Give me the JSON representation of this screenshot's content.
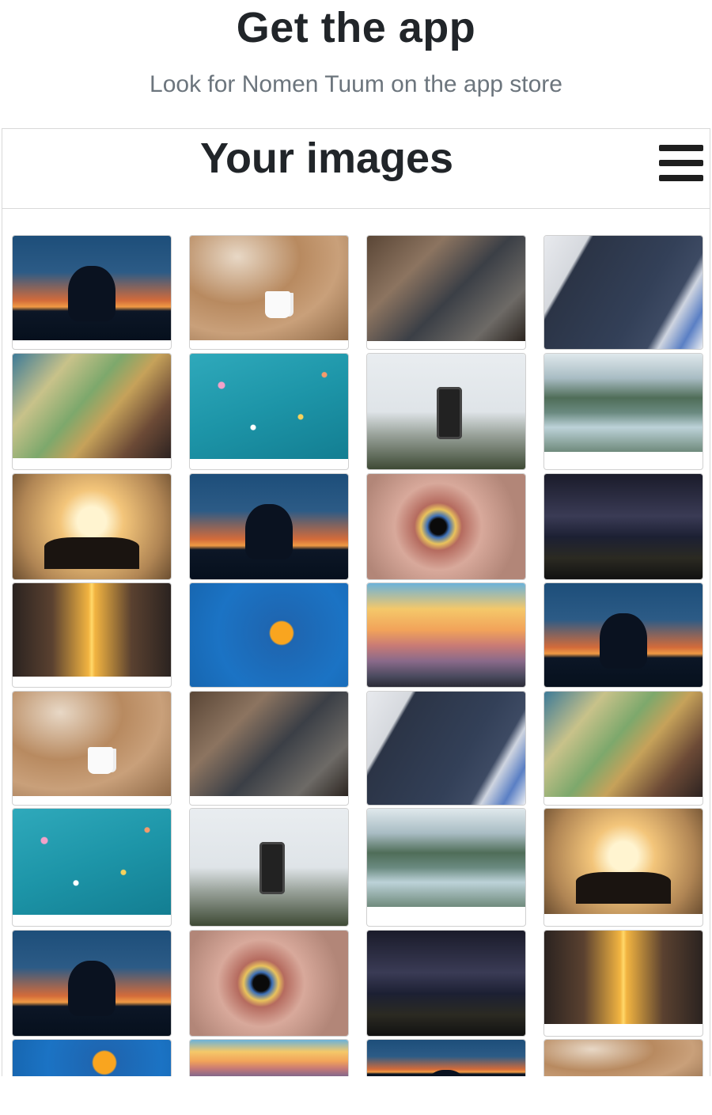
{
  "promo": {
    "title": "Get the app",
    "subtitle": "Look for Nomen Tuum on the app store"
  },
  "gallery": {
    "title": "Your images",
    "menu_icon": "hamburger-menu-icon",
    "images": [
      "sunset-man",
      "coffee",
      "team",
      "dash",
      "map",
      "confetti",
      "phone",
      "lake",
      "friends",
      "sunset-man",
      "eye",
      "storm",
      "street",
      "orange",
      "mountains",
      "sunset-man",
      "coffee",
      "team",
      "dash",
      "map",
      "confetti",
      "phone",
      "lake",
      "friends",
      "sunset-man",
      "eye",
      "storm",
      "street",
      "orange",
      "mountains",
      "sunset-man",
      "coffee"
    ]
  }
}
